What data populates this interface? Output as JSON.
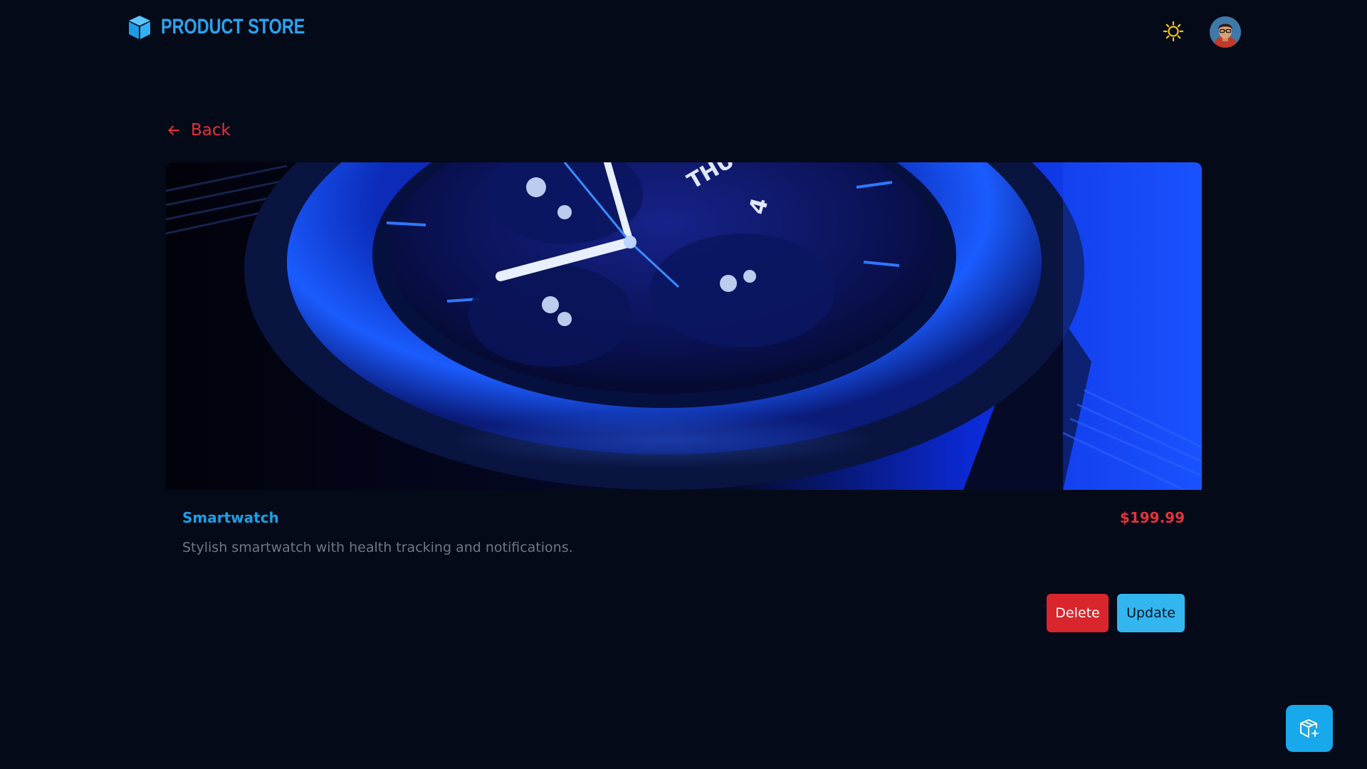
{
  "header": {
    "brand": "PRODUCT STORE",
    "logo_icon": "cube-icon",
    "theme_toggle_icon": "sun-icon",
    "avatar_icon": "user-avatar"
  },
  "navigation": {
    "back_label": "Back",
    "back_icon": "arrow-left-icon"
  },
  "product": {
    "image_alt": "Smartwatch",
    "name": "Smartwatch",
    "price": "$199.99",
    "description": "Stylish smartwatch with health tracking and notifications."
  },
  "actions": {
    "delete_label": "Delete",
    "update_label": "Update"
  },
  "fab": {
    "icon": "add-package-icon"
  },
  "colors": {
    "background": "#040a18",
    "brand": "#29a3f0",
    "accent_red": "#e5323a",
    "accent_blue": "#33b6ef",
    "muted_text": "#6e7787"
  }
}
